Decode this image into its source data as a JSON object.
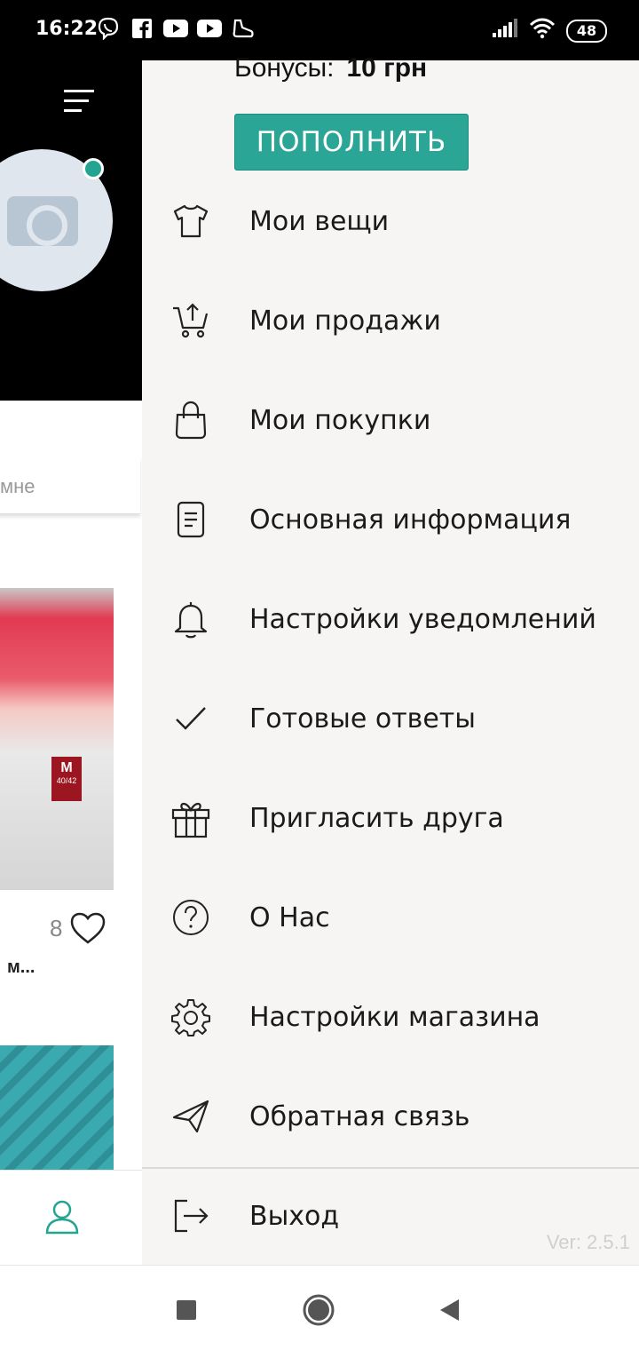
{
  "status_bar": {
    "time": "16:22",
    "battery": "48",
    "left_icons": [
      "viber-icon",
      "facebook-icon",
      "youtube-icon",
      "youtube-icon",
      "shoe-icon"
    ],
    "right_icons": [
      "signal-icon",
      "wifi-icon",
      "battery-icon"
    ]
  },
  "drawer": {
    "bonus_label": "Бонусы:",
    "bonus_value": "10 грн",
    "topup_button": "ПОПОЛНИТЬ",
    "items": [
      {
        "label": "Мои вещи",
        "icon": "tshirt-icon"
      },
      {
        "label": "Мои продажи",
        "icon": "cart-upload-icon"
      },
      {
        "label": "Мои покупки",
        "icon": "shopping-bag-icon"
      },
      {
        "label": "Основная информация",
        "icon": "document-icon"
      },
      {
        "label": "Настройки уведомлений",
        "icon": "bell-icon"
      },
      {
        "label": "Готовые ответы",
        "icon": "checkmark-icon"
      },
      {
        "label": "Пригласить друга",
        "icon": "gift-icon"
      },
      {
        "label": "О Нас",
        "icon": "question-circle-icon"
      },
      {
        "label": "Настройки магазина",
        "icon": "gear-icon"
      },
      {
        "label": "Обратная связь",
        "icon": "paper-plane-icon"
      },
      {
        "label": "Выход",
        "icon": "logout-icon"
      }
    ],
    "version": "Ver: 2.5.1"
  },
  "background_screen": {
    "search_placeholder": "мне",
    "product_likes": "8",
    "product_title": "м...",
    "size_tag": "M",
    "size_range": "40/42"
  },
  "colors": {
    "accent": "#2ba596",
    "drawer_background": "#f6f5f4",
    "status_bar": "#000000"
  }
}
